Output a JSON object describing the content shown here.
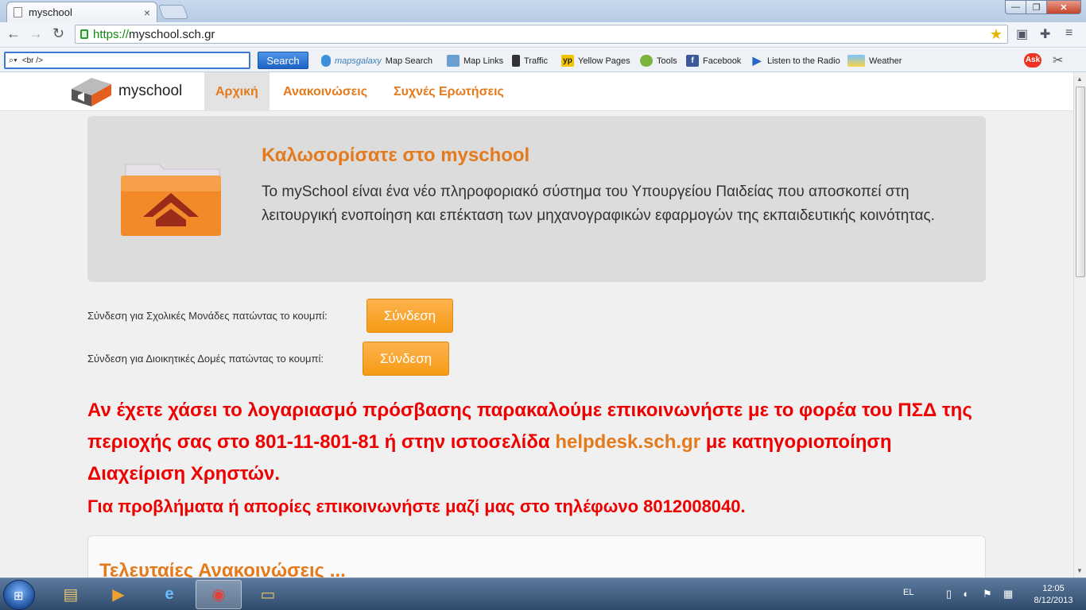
{
  "browser": {
    "tab_title": "myschool",
    "url_scheme": "https://",
    "url_host": "myschool.sch.gr",
    "toolbar_search_value": "<br />",
    "toolbar_search_button": "Search",
    "toolbar_items": [
      "Map Search",
      "Map Links",
      "Traffic",
      "Yellow Pages",
      "Tools",
      "Facebook",
      "Listen to the Radio",
      "Weather"
    ],
    "mapsgalaxy_label": "mapsgalaxy",
    "ask_label": "Ask"
  },
  "site": {
    "logo_text": "myschool",
    "nav": [
      "Αρχική",
      "Ανακοινώσεις",
      "Συχνές Ερωτήσεις"
    ],
    "hero_title": "Καλωσορίσατε στο myschool",
    "hero_text": "Το mySchool είναι ένα νέο πληροφοριακό σύστημα του Υπουργείου Παιδείας που αποσκοπεί στη λειτουργική ενοποίηση και επέκταση των μηχανογραφικών εφαρμογών της εκπαιδευτικής κοινότητας.",
    "login_school_label": "Σύνδεση για Σχολικές Μονάδες πατώντας το κουμπί:",
    "login_admin_label": "Σύνδεση για Διοικητικές Δομές πατώντας το κουμπί:",
    "login_button": "Σύνδεση",
    "notice_part1": "Αν έχετε χάσει το λογαριασμό πρόσβασης παρακαλούμε επικοινωνήστε με το φορέα του ΠΣΔ της περιοχής σας στο 801-11-801-81 ή στην ιστοσελίδα ",
    "notice_link": "helpdesk.sch.gr",
    "notice_part2": " με κατηγοριοποίηση Διαχείριση Χρηστών.",
    "notice_phone": "Για προβλήματα ή απορίες επικοινωνήστε μαζί μας στο τηλέφωνο 8012008040.",
    "news_title": "Τελευταίες Ανακοινώσεις ..."
  },
  "taskbar": {
    "lang": "EL",
    "time": "12:05",
    "date": "8/12/2013"
  },
  "colors": {
    "brand_orange": "#e47a1b",
    "notice_red": "#ee0000",
    "button_orange": "#f7a52c"
  }
}
